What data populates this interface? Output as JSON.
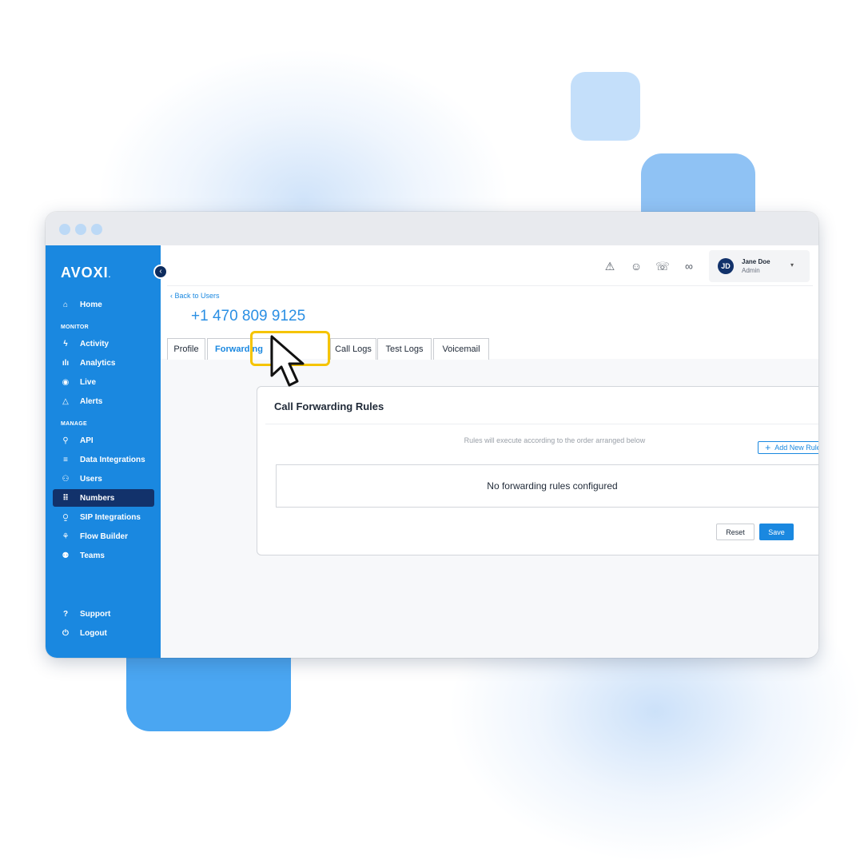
{
  "colors": {
    "sidebar_bg": "#1a88e0",
    "sidebar_active": "#12326b",
    "accent": "#1a88e0",
    "highlight": "#f5c400"
  },
  "sidebar": {
    "logo": "AVOXI",
    "logo_mark": ".",
    "collapse_icon": "chevron-left-icon",
    "home": {
      "label": "Home",
      "icon": "home-icon"
    },
    "monitor_label": "MONITOR",
    "monitor_items": [
      {
        "label": "Activity",
        "icon": "bolt-icon"
      },
      {
        "label": "Analytics",
        "icon": "bar-chart-icon"
      },
      {
        "label": "Live",
        "icon": "live-icon"
      },
      {
        "label": "Alerts",
        "icon": "warning-icon"
      }
    ],
    "manage_label": "MANAGE",
    "manage_items": [
      {
        "label": "API",
        "icon": "plug-icon"
      },
      {
        "label": "Data Integrations",
        "icon": "database-icon"
      },
      {
        "label": "Users",
        "icon": "user-icon"
      },
      {
        "label": "Numbers",
        "icon": "dialpad-icon",
        "active": true
      },
      {
        "label": "SIP Integrations",
        "icon": "sip-icon"
      },
      {
        "label": "Flow Builder",
        "icon": "flow-icon"
      },
      {
        "label": "Teams",
        "icon": "team-icon"
      }
    ],
    "footer_items": [
      {
        "label": "Support",
        "icon": "help-icon"
      },
      {
        "label": "Logout",
        "icon": "power-icon"
      }
    ]
  },
  "header": {
    "icons": [
      "alert-icon",
      "user-circle-icon",
      "phone-forward-icon",
      "voicemail-icon"
    ],
    "user": {
      "initials": "JD",
      "name": "Jane Doe",
      "role": "Admin"
    }
  },
  "page": {
    "back_link": "Back to Users",
    "phone_number": "+1 470 809 9125",
    "tabs": [
      {
        "label": "Profile"
      },
      {
        "label": "Forwarding",
        "active": true
      },
      {
        "label": "Call Logs"
      },
      {
        "label": "Test Logs"
      },
      {
        "label": "Voicemail"
      }
    ]
  },
  "card": {
    "title": "Call Forwarding Rules",
    "hint": "Rules will execute according to the order arranged below",
    "add_rule_label": "Add New Rule",
    "empty_message": "No forwarding rules configured",
    "reset_label": "Reset",
    "save_label": "Save"
  }
}
